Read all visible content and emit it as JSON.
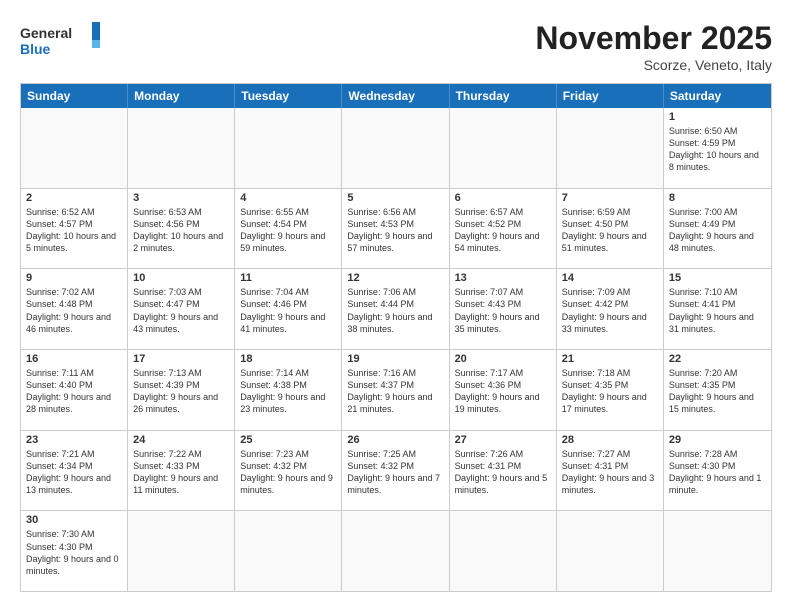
{
  "header": {
    "logo_general": "General",
    "logo_blue": "Blue",
    "month_title": "November 2025",
    "subtitle": "Scorze, Veneto, Italy"
  },
  "weekdays": [
    "Sunday",
    "Monday",
    "Tuesday",
    "Wednesday",
    "Thursday",
    "Friday",
    "Saturday"
  ],
  "rows": [
    [
      {
        "day": "",
        "info": ""
      },
      {
        "day": "",
        "info": ""
      },
      {
        "day": "",
        "info": ""
      },
      {
        "day": "",
        "info": ""
      },
      {
        "day": "",
        "info": ""
      },
      {
        "day": "",
        "info": ""
      },
      {
        "day": "1",
        "info": "Sunrise: 6:50 AM\nSunset: 4:59 PM\nDaylight: 10 hours and 8 minutes."
      }
    ],
    [
      {
        "day": "2",
        "info": "Sunrise: 6:52 AM\nSunset: 4:57 PM\nDaylight: 10 hours and 5 minutes."
      },
      {
        "day": "3",
        "info": "Sunrise: 6:53 AM\nSunset: 4:56 PM\nDaylight: 10 hours and 2 minutes."
      },
      {
        "day": "4",
        "info": "Sunrise: 6:55 AM\nSunset: 4:54 PM\nDaylight: 9 hours and 59 minutes."
      },
      {
        "day": "5",
        "info": "Sunrise: 6:56 AM\nSunset: 4:53 PM\nDaylight: 9 hours and 57 minutes."
      },
      {
        "day": "6",
        "info": "Sunrise: 6:57 AM\nSunset: 4:52 PM\nDaylight: 9 hours and 54 minutes."
      },
      {
        "day": "7",
        "info": "Sunrise: 6:59 AM\nSunset: 4:50 PM\nDaylight: 9 hours and 51 minutes."
      },
      {
        "day": "8",
        "info": "Sunrise: 7:00 AM\nSunset: 4:49 PM\nDaylight: 9 hours and 48 minutes."
      }
    ],
    [
      {
        "day": "9",
        "info": "Sunrise: 7:02 AM\nSunset: 4:48 PM\nDaylight: 9 hours and 46 minutes."
      },
      {
        "day": "10",
        "info": "Sunrise: 7:03 AM\nSunset: 4:47 PM\nDaylight: 9 hours and 43 minutes."
      },
      {
        "day": "11",
        "info": "Sunrise: 7:04 AM\nSunset: 4:46 PM\nDaylight: 9 hours and 41 minutes."
      },
      {
        "day": "12",
        "info": "Sunrise: 7:06 AM\nSunset: 4:44 PM\nDaylight: 9 hours and 38 minutes."
      },
      {
        "day": "13",
        "info": "Sunrise: 7:07 AM\nSunset: 4:43 PM\nDaylight: 9 hours and 35 minutes."
      },
      {
        "day": "14",
        "info": "Sunrise: 7:09 AM\nSunset: 4:42 PM\nDaylight: 9 hours and 33 minutes."
      },
      {
        "day": "15",
        "info": "Sunrise: 7:10 AM\nSunset: 4:41 PM\nDaylight: 9 hours and 31 minutes."
      }
    ],
    [
      {
        "day": "16",
        "info": "Sunrise: 7:11 AM\nSunset: 4:40 PM\nDaylight: 9 hours and 28 minutes."
      },
      {
        "day": "17",
        "info": "Sunrise: 7:13 AM\nSunset: 4:39 PM\nDaylight: 9 hours and 26 minutes."
      },
      {
        "day": "18",
        "info": "Sunrise: 7:14 AM\nSunset: 4:38 PM\nDaylight: 9 hours and 23 minutes."
      },
      {
        "day": "19",
        "info": "Sunrise: 7:16 AM\nSunset: 4:37 PM\nDaylight: 9 hours and 21 minutes."
      },
      {
        "day": "20",
        "info": "Sunrise: 7:17 AM\nSunset: 4:36 PM\nDaylight: 9 hours and 19 minutes."
      },
      {
        "day": "21",
        "info": "Sunrise: 7:18 AM\nSunset: 4:35 PM\nDaylight: 9 hours and 17 minutes."
      },
      {
        "day": "22",
        "info": "Sunrise: 7:20 AM\nSunset: 4:35 PM\nDaylight: 9 hours and 15 minutes."
      }
    ],
    [
      {
        "day": "23",
        "info": "Sunrise: 7:21 AM\nSunset: 4:34 PM\nDaylight: 9 hours and 13 minutes."
      },
      {
        "day": "24",
        "info": "Sunrise: 7:22 AM\nSunset: 4:33 PM\nDaylight: 9 hours and 11 minutes."
      },
      {
        "day": "25",
        "info": "Sunrise: 7:23 AM\nSunset: 4:32 PM\nDaylight: 9 hours and 9 minutes."
      },
      {
        "day": "26",
        "info": "Sunrise: 7:25 AM\nSunset: 4:32 PM\nDaylight: 9 hours and 7 minutes."
      },
      {
        "day": "27",
        "info": "Sunrise: 7:26 AM\nSunset: 4:31 PM\nDaylight: 9 hours and 5 minutes."
      },
      {
        "day": "28",
        "info": "Sunrise: 7:27 AM\nSunset: 4:31 PM\nDaylight: 9 hours and 3 minutes."
      },
      {
        "day": "29",
        "info": "Sunrise: 7:28 AM\nSunset: 4:30 PM\nDaylight: 9 hours and 1 minute."
      }
    ],
    [
      {
        "day": "30",
        "info": "Sunrise: 7:30 AM\nSunset: 4:30 PM\nDaylight: 9 hours and 0 minutes."
      },
      {
        "day": "",
        "info": ""
      },
      {
        "day": "",
        "info": ""
      },
      {
        "day": "",
        "info": ""
      },
      {
        "day": "",
        "info": ""
      },
      {
        "day": "",
        "info": ""
      },
      {
        "day": "",
        "info": ""
      }
    ]
  ]
}
